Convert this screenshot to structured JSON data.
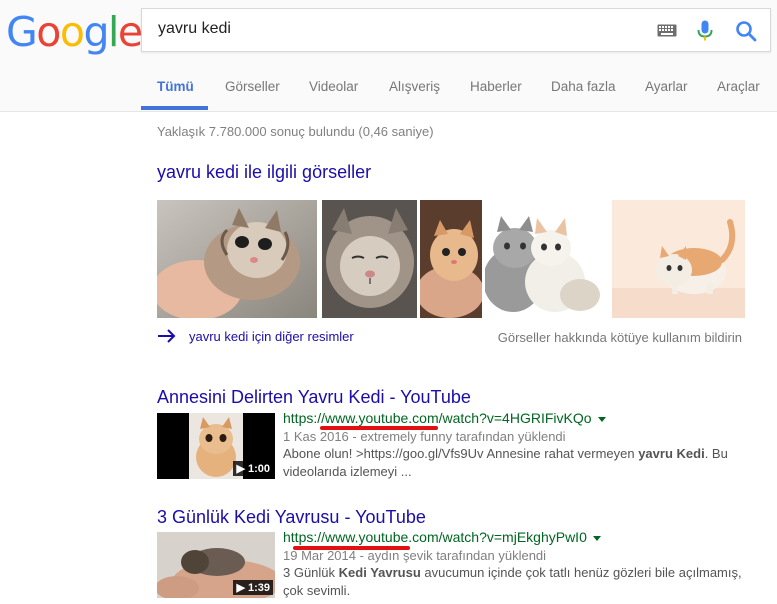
{
  "search": {
    "query": "yavru kedi"
  },
  "tabs": [
    {
      "label": "Tümü",
      "active": true
    },
    {
      "label": "Görseller"
    },
    {
      "label": "Videolar"
    },
    {
      "label": "Alışveriş"
    },
    {
      "label": "Haberler"
    },
    {
      "label": "Daha fazla"
    },
    {
      "label": "Ayarlar"
    },
    {
      "label": "Araçlar"
    }
  ],
  "stats": "Yaklaşık 7.780.000 sonuç bulundu (0,46 saniye)",
  "images_section": {
    "heading": "yavru kedi ile ilgili görseller",
    "more_link": "yavru kedi için diğer resimler",
    "report_link": "Görseller hakkında kötüye kullanım bildirin"
  },
  "results": [
    {
      "title": "Annesini Delirten Yavru Kedi - YouTube",
      "url": "https://www.youtube.com/watch?v=4HGRIFivKQo",
      "meta": "1 Kas 2016 - extremely funny tarafından yüklendi",
      "snippet_a": "Abone olun! >https://goo.gl/Vfs9Uv Annesine rahat vermeyen ",
      "snippet_b": "yavru Kedi",
      "snippet_c": ". Bu videolarıda izlemeyi ...",
      "duration": "1:00"
    },
    {
      "title": "3 Günlük Kedi Yavrusu - YouTube",
      "url": "https://www.youtube.com/watch?v=mjEkghyPwI0",
      "meta": "19 Mar 2014 - aydın şevik tarafından yüklendi",
      "snippet_a": "3 Günlük ",
      "snippet_b": "Kedi Yavrusu",
      "snippet_c": " avucumun içinde çok tatlı henüz gözleri bile açılmamış, çok sevimli.",
      "duration": "1:39"
    }
  ],
  "logo": {
    "letters": [
      "G",
      "o",
      "o",
      "g",
      "l",
      "e"
    ],
    "colors": [
      "#4285F4",
      "#EA4335",
      "#FBBC05",
      "#4285F4",
      "#34A853",
      "#EA4335"
    ]
  }
}
